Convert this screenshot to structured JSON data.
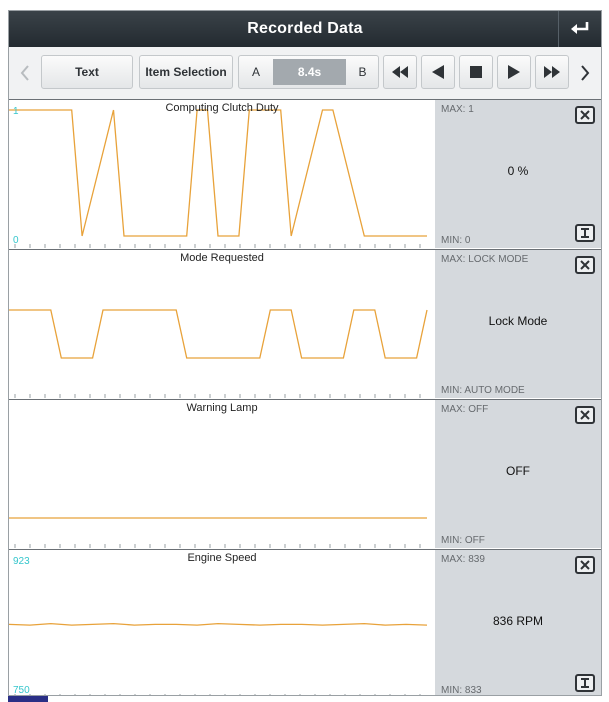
{
  "header": {
    "title": "Recorded Data",
    "back_icon": "return-arrow-icon"
  },
  "toolbar": {
    "prev_icon": "chevron-left-icon",
    "text_label": "Text",
    "item_selection_label": "Item Selection",
    "a_label": "A",
    "time_label": "8.4s",
    "b_label": "B",
    "rewind_icon": "fast-rewind-icon",
    "step_back_icon": "step-back-icon",
    "stop_icon": "stop-icon",
    "step_forward_icon": "step-forward-icon",
    "fast_forward_icon": "fast-forward-icon",
    "next_icon": "chevron-right-icon"
  },
  "colors": {
    "trace": "#e8a23a",
    "axis_text": "#35c6cc",
    "panel": "#d5d9dd",
    "header": "#2b3338"
  },
  "channels": [
    {
      "title": "Computing Clutch Duty",
      "graph_max": "1",
      "graph_min": "0",
      "info_max": "MAX: 1",
      "value": "0 %",
      "info_min": "MIN: 0",
      "show_scale": true
    },
    {
      "title": "Mode Requested",
      "graph_max": "",
      "graph_min": "",
      "info_max": "MAX: LOCK MODE",
      "value": "Lock Mode",
      "info_min": "MIN: AUTO MODE",
      "show_scale": false
    },
    {
      "title": "Warning Lamp",
      "graph_max": "",
      "graph_min": "",
      "info_max": "MAX: OFF",
      "value": "OFF",
      "info_min": "MIN: OFF",
      "show_scale": false
    },
    {
      "title": "Engine Speed",
      "graph_max": "923",
      "graph_min": "750",
      "info_max": "MAX: 839",
      "value": "836 RPM",
      "info_min": "MIN: 833",
      "show_scale": true
    }
  ],
  "chart_data": [
    {
      "type": "line",
      "title": "Computing Clutch Duty",
      "ylim": [
        0,
        1
      ],
      "x": [
        0,
        6,
        7,
        10,
        11,
        17,
        18,
        19,
        20,
        22,
        23,
        26,
        27,
        30,
        31,
        34,
        40
      ],
      "series": [
        {
          "values": [
            1,
            1,
            0,
            1,
            0,
            0,
            1,
            1,
            0,
            0,
            1,
            1,
            0,
            1,
            1,
            0,
            0
          ]
        }
      ]
    },
    {
      "type": "line",
      "title": "Mode Requested",
      "categories_y": [
        "AUTO MODE",
        "LOCK MODE"
      ],
      "x": [
        0,
        4,
        5,
        8,
        9,
        16,
        17,
        24,
        25,
        27,
        28,
        32,
        33,
        35,
        36,
        39,
        40
      ],
      "series": [
        {
          "values": [
            1,
            1,
            0,
            0,
            1,
            1,
            0,
            0,
            1,
            1,
            0,
            0,
            1,
            1,
            0,
            0,
            1
          ]
        }
      ]
    },
    {
      "type": "line",
      "title": "Warning Lamp",
      "categories_y": [
        "OFF"
      ],
      "x": [
        0,
        40
      ],
      "series": [
        {
          "values": [
            0,
            0
          ]
        }
      ]
    },
    {
      "type": "line",
      "title": "Engine Speed",
      "ylim": [
        750,
        923
      ],
      "x": [
        0,
        2,
        4,
        6,
        8,
        10,
        12,
        14,
        16,
        18,
        20,
        22,
        24,
        26,
        28,
        30,
        32,
        34,
        36,
        38,
        40
      ],
      "series": [
        {
          "values": [
            836,
            835,
            837,
            835,
            836,
            837,
            835,
            836,
            836,
            835,
            837,
            836,
            835,
            836,
            836,
            835,
            836,
            837,
            835,
            836,
            835
          ]
        }
      ]
    }
  ]
}
